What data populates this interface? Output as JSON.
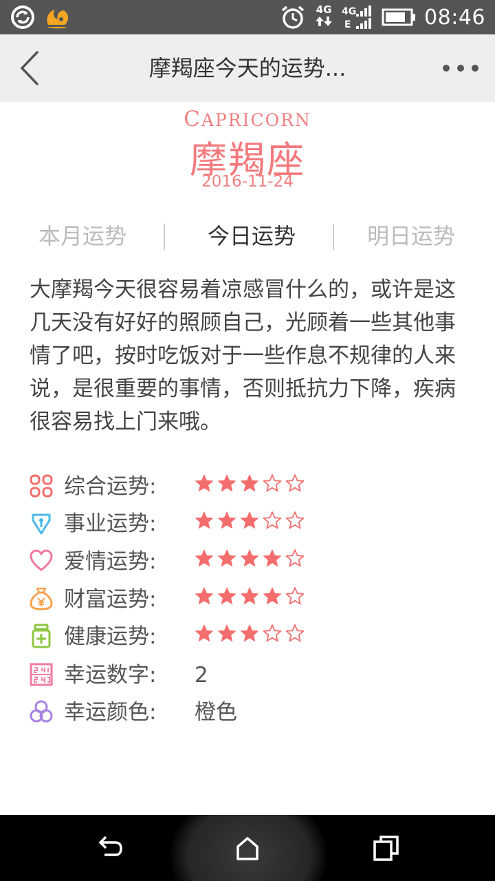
{
  "status_bar": {
    "time": "08:46",
    "net_top": "4G",
    "signal_label_top": "4G",
    "signal_label_bottom": "E"
  },
  "navbar": {
    "title": "摩羯座今天的运势..."
  },
  "header": {
    "sign_en_first": "C",
    "sign_en_rest": "APRICORN",
    "sign_cn": "摩羯座",
    "date": "2016-11-24"
  },
  "tabs": [
    {
      "label": "本月运势",
      "active": false
    },
    {
      "label": "今日运势",
      "active": true
    },
    {
      "label": "明日运势",
      "active": false
    }
  ],
  "description": "大摩羯今天很容易着凉感冒什么的，或许是这几天没有好好的照顾自己，光顾着一些其他事情了吧，按时吃饭对于一些作息不规律的人来说，是很重要的事情，否则抵抗力下降，疾病很容易找上门来哦。",
  "fortunes": [
    {
      "icon": "overall-grid-icon",
      "label": "综合运势:",
      "stars": 3,
      "max": 5,
      "color": "#f46d6d"
    },
    {
      "icon": "career-pen-icon",
      "label": "事业运势:",
      "stars": 3,
      "max": 5,
      "color": "#4ab8e8"
    },
    {
      "icon": "love-heart-icon",
      "label": "爱情运势:",
      "stars": 4,
      "max": 5,
      "color": "#f07aa0"
    },
    {
      "icon": "wealth-moneybag-icon",
      "label": "财富运势:",
      "stars": 4,
      "max": 5,
      "color": "#f5a14b"
    },
    {
      "icon": "health-bottle-icon",
      "label": "健康运势:",
      "stars": 3,
      "max": 5,
      "color": "#8cc63f"
    }
  ],
  "lucky": [
    {
      "icon": "lucky-number-icon",
      "label": "幸运数字:",
      "value": "2",
      "color": "#f07aa0"
    },
    {
      "icon": "lucky-color-icon",
      "label": "幸运颜色:",
      "value": "橙色",
      "color": "#a783e0"
    }
  ],
  "colors": {
    "accent": "#f4797d",
    "star": "#f46d6d"
  }
}
